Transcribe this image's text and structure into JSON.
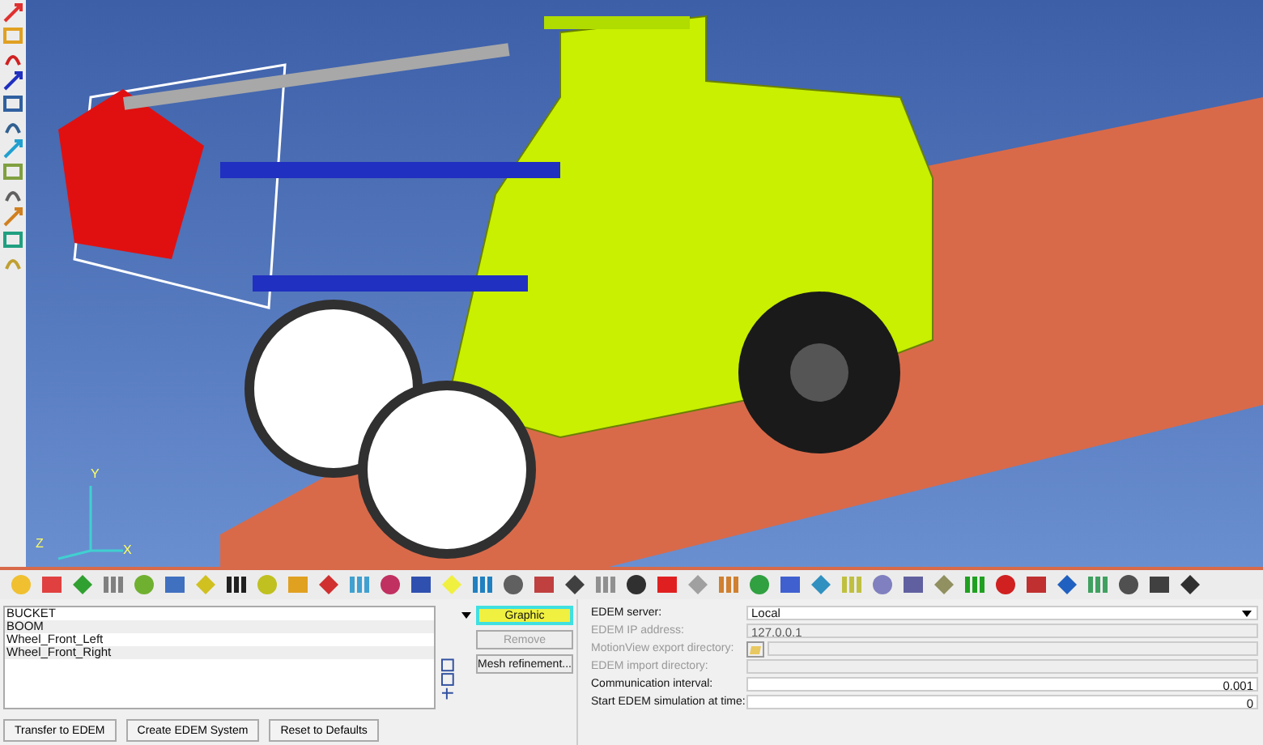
{
  "viewport": {
    "triad": [
      {
        "axis": "Y"
      },
      {
        "axis": "Z"
      },
      {
        "axis": "X"
      }
    ]
  },
  "body_list": {
    "items": [
      "BUCKET",
      "BOOM",
      "Wheel_Front_Left",
      "Wheel_Front_Right"
    ]
  },
  "graphic_button": {
    "label": "Graphic",
    "selected": true
  },
  "remove_button": {
    "label": "Remove",
    "disabled": true
  },
  "mesh_button": {
    "label": "Mesh refinement...",
    "disabled": false
  },
  "form": [
    {
      "kind": "dropdown",
      "label": "EDEM server:",
      "value": "Local",
      "disabled": false
    },
    {
      "kind": "text",
      "label": "EDEM IP address:",
      "value": "127.0.0.1",
      "disabled": true
    },
    {
      "kind": "folder",
      "label": "MotionView export directory:",
      "disabled": true
    },
    {
      "kind": "text",
      "label": "EDEM import directory:",
      "disabled": true
    },
    {
      "kind": "number",
      "label": "Communication interval:",
      "value": "0.001",
      "disabled": false
    },
    {
      "kind": "number",
      "label": "Start EDEM simulation at time:",
      "value": "0",
      "disabled": false
    }
  ],
  "bottom_buttons": [
    "Transfer to EDEM",
    "Create EDEM System",
    "Reset to Defaults"
  ]
}
